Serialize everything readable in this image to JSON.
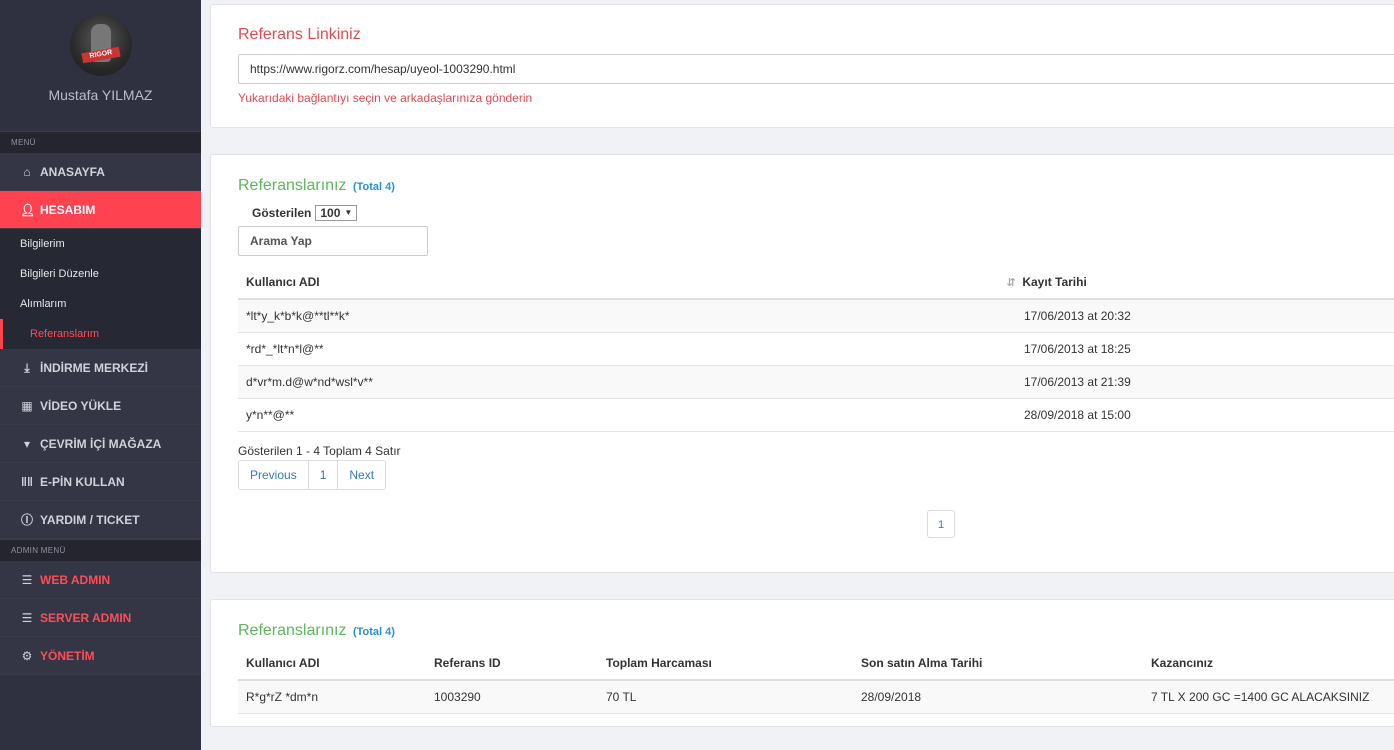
{
  "sidebar": {
    "user_name": "Mustafa YILMAZ",
    "avatar_logo": "RIGOR",
    "menu_header": "MENÜ",
    "admin_header": "ADMIN MENÜ",
    "items": [
      {
        "label": "ANASAYFA",
        "icon": "home-icon"
      },
      {
        "label": "HESABIM",
        "icon": "user-icon"
      },
      {
        "label": "İNDİRME MERKEZİ",
        "icon": "download-icon"
      },
      {
        "label": "VİDEO YÜKLE",
        "icon": "video-icon"
      },
      {
        "label": "ÇEVRİM İÇİ MAĞAZA",
        "icon": "cart-icon"
      },
      {
        "label": "E-PİN KULLAN",
        "icon": "barcode-icon"
      },
      {
        "label": "YARDIM / TICKET",
        "icon": "info-icon"
      }
    ],
    "sub_items": [
      "Bilgilerim",
      "Bilgileri Düzenle",
      "Alımlarım",
      "Referanslarım"
    ],
    "admin_items": [
      {
        "label": "WEB ADMIN",
        "icon": "list-icon"
      },
      {
        "label": "SERVER ADMIN",
        "icon": "list-icon"
      },
      {
        "label": "YÖNETİM",
        "icon": "gear-icon"
      }
    ],
    "colors": {
      "bg": "#2f3140",
      "accent": "#ff424f"
    }
  },
  "referral_link": {
    "title": "Referans Linkiniz",
    "url": "https://www.rigorz.com/hesap/uyeol-1003290.html",
    "hint": "Yukarıdaki bağlantıyı seçin ve arkadaşlarınıza gönderin"
  },
  "referrals": {
    "title": "Referanslarınız",
    "total": "(Total 4)",
    "show_label": "Gösterilen",
    "page_size": "100",
    "search_placeholder": "Arama Yap",
    "columns": [
      "Kullanıcı ADI",
      "Kayıt Tarihi"
    ],
    "rows": [
      [
        "*lt*y_k*b*k@**tl**k*",
        "17/06/2013 at 20:32"
      ],
      [
        "*rd*_*lt*n*l@**",
        "17/06/2013 at 18:25"
      ],
      [
        "d*vr*m.d@w*nd*wsl*v**",
        "17/06/2013 at 21:39"
      ],
      [
        "y*n**@**",
        "28/09/2018 at 15:00"
      ]
    ],
    "info": "Gösterilen 1 - 4 Toplam 4 Satır",
    "pager": {
      "previous": "Previous",
      "page": "1",
      "next": "Next"
    },
    "bottom_page": "1"
  },
  "summary": {
    "title": "Referanslarınız",
    "total": "(Total 4)",
    "columns": [
      "Kullanıcı ADI",
      "Referans ID",
      "Toplam Harcaması",
      "Son satın Alma Tarihi",
      "Kazancınız"
    ],
    "row": [
      "R*g*rZ *dm*n",
      "1003290",
      "70 TL",
      "28/09/2018",
      "7 TL X 200 GC =1400 GC ALACAKSINIZ"
    ]
  }
}
